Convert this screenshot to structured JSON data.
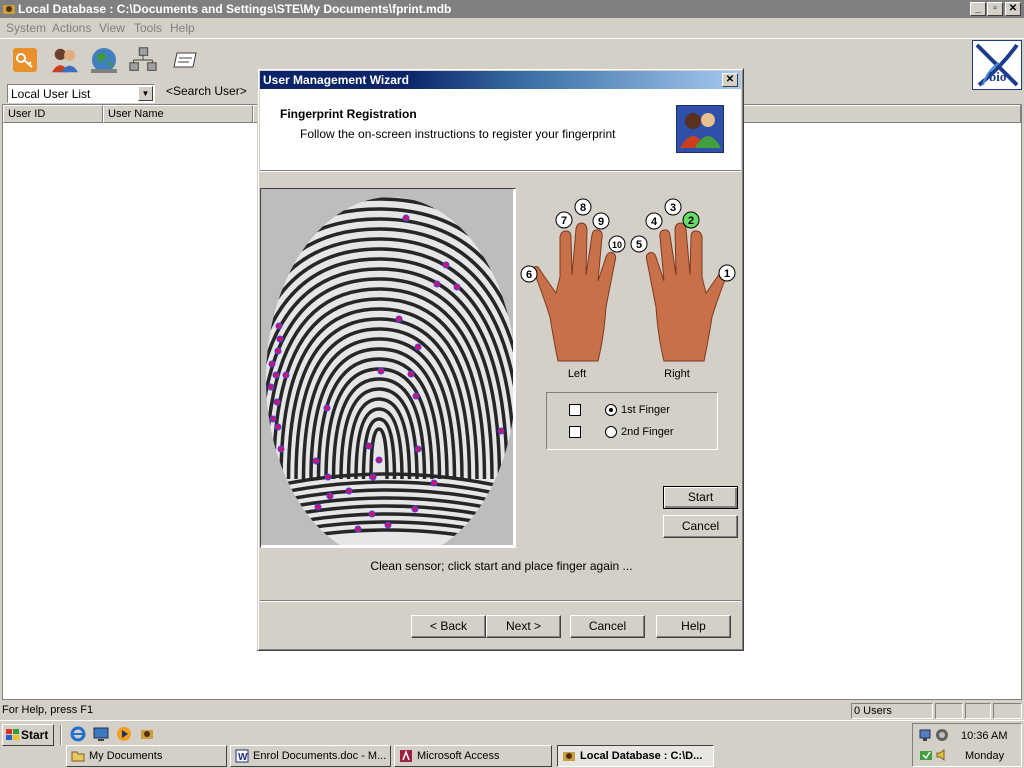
{
  "window": {
    "title": "Local Database : C:\\Documents and Settings\\STE\\My Documents\\fprint.mdb",
    "controls": {
      "minimize": "_",
      "restore": "▫",
      "close": "✕"
    }
  },
  "menu": [
    "System",
    "Actions",
    "View",
    "Tools",
    "Help"
  ],
  "toolbar": {
    "icons": [
      "key-icon",
      "users-icon",
      "globe-icon",
      "network-icon",
      "card-icon"
    ],
    "logo_text": "bio"
  },
  "list": {
    "selected": "Local User List",
    "search_label": "<Search User>",
    "columns": [
      "User ID",
      "User Name"
    ]
  },
  "status": {
    "help": "For Help, press F1",
    "users": "0 Users"
  },
  "taskbar": {
    "start": "Start",
    "quicklaunch": [
      "ie-icon",
      "desktop-icon",
      "media-icon",
      "app-icon"
    ],
    "tasks": [
      {
        "label": "My Documents",
        "icon": "folder-icon"
      },
      {
        "label": "Enrol Documents.doc - M...",
        "icon": "word-icon"
      },
      {
        "label": "Microsoft Access",
        "icon": "access-icon"
      },
      {
        "label": "Local Database : C:\\D...",
        "icon": "app-icon",
        "active": true
      }
    ],
    "clock": "10:36 AM",
    "day": "Monday"
  },
  "dialog": {
    "title": "User Management Wizard",
    "close": "✕",
    "heading": "Fingerprint Registration",
    "subheading": "Follow the on-screen instructions to register your fingerprint",
    "hands": {
      "left_label": "Left",
      "right_label": "Right",
      "fingers": [
        "1",
        "2",
        "3",
        "4",
        "5",
        "6",
        "7",
        "8",
        "9",
        "10"
      ],
      "highlighted": "2"
    },
    "options": {
      "first_finger": "1st Finger",
      "second_finger": "2nd Finger",
      "selected": "1st Finger"
    },
    "buttons": {
      "start": "Start",
      "cancel_capture": "Cancel",
      "back": "< Back",
      "next": "Next >",
      "cancel": "Cancel",
      "help": "Help"
    },
    "status_message": "Clean sensor; click start and place finger again  ..."
  },
  "colors": {
    "titlebar_inactive": "#808080",
    "dialog_title_start": "#0a246a",
    "highlight_finger": "#66dd66",
    "minutia_point": "#d4145a",
    "skin": "#c8704a"
  }
}
